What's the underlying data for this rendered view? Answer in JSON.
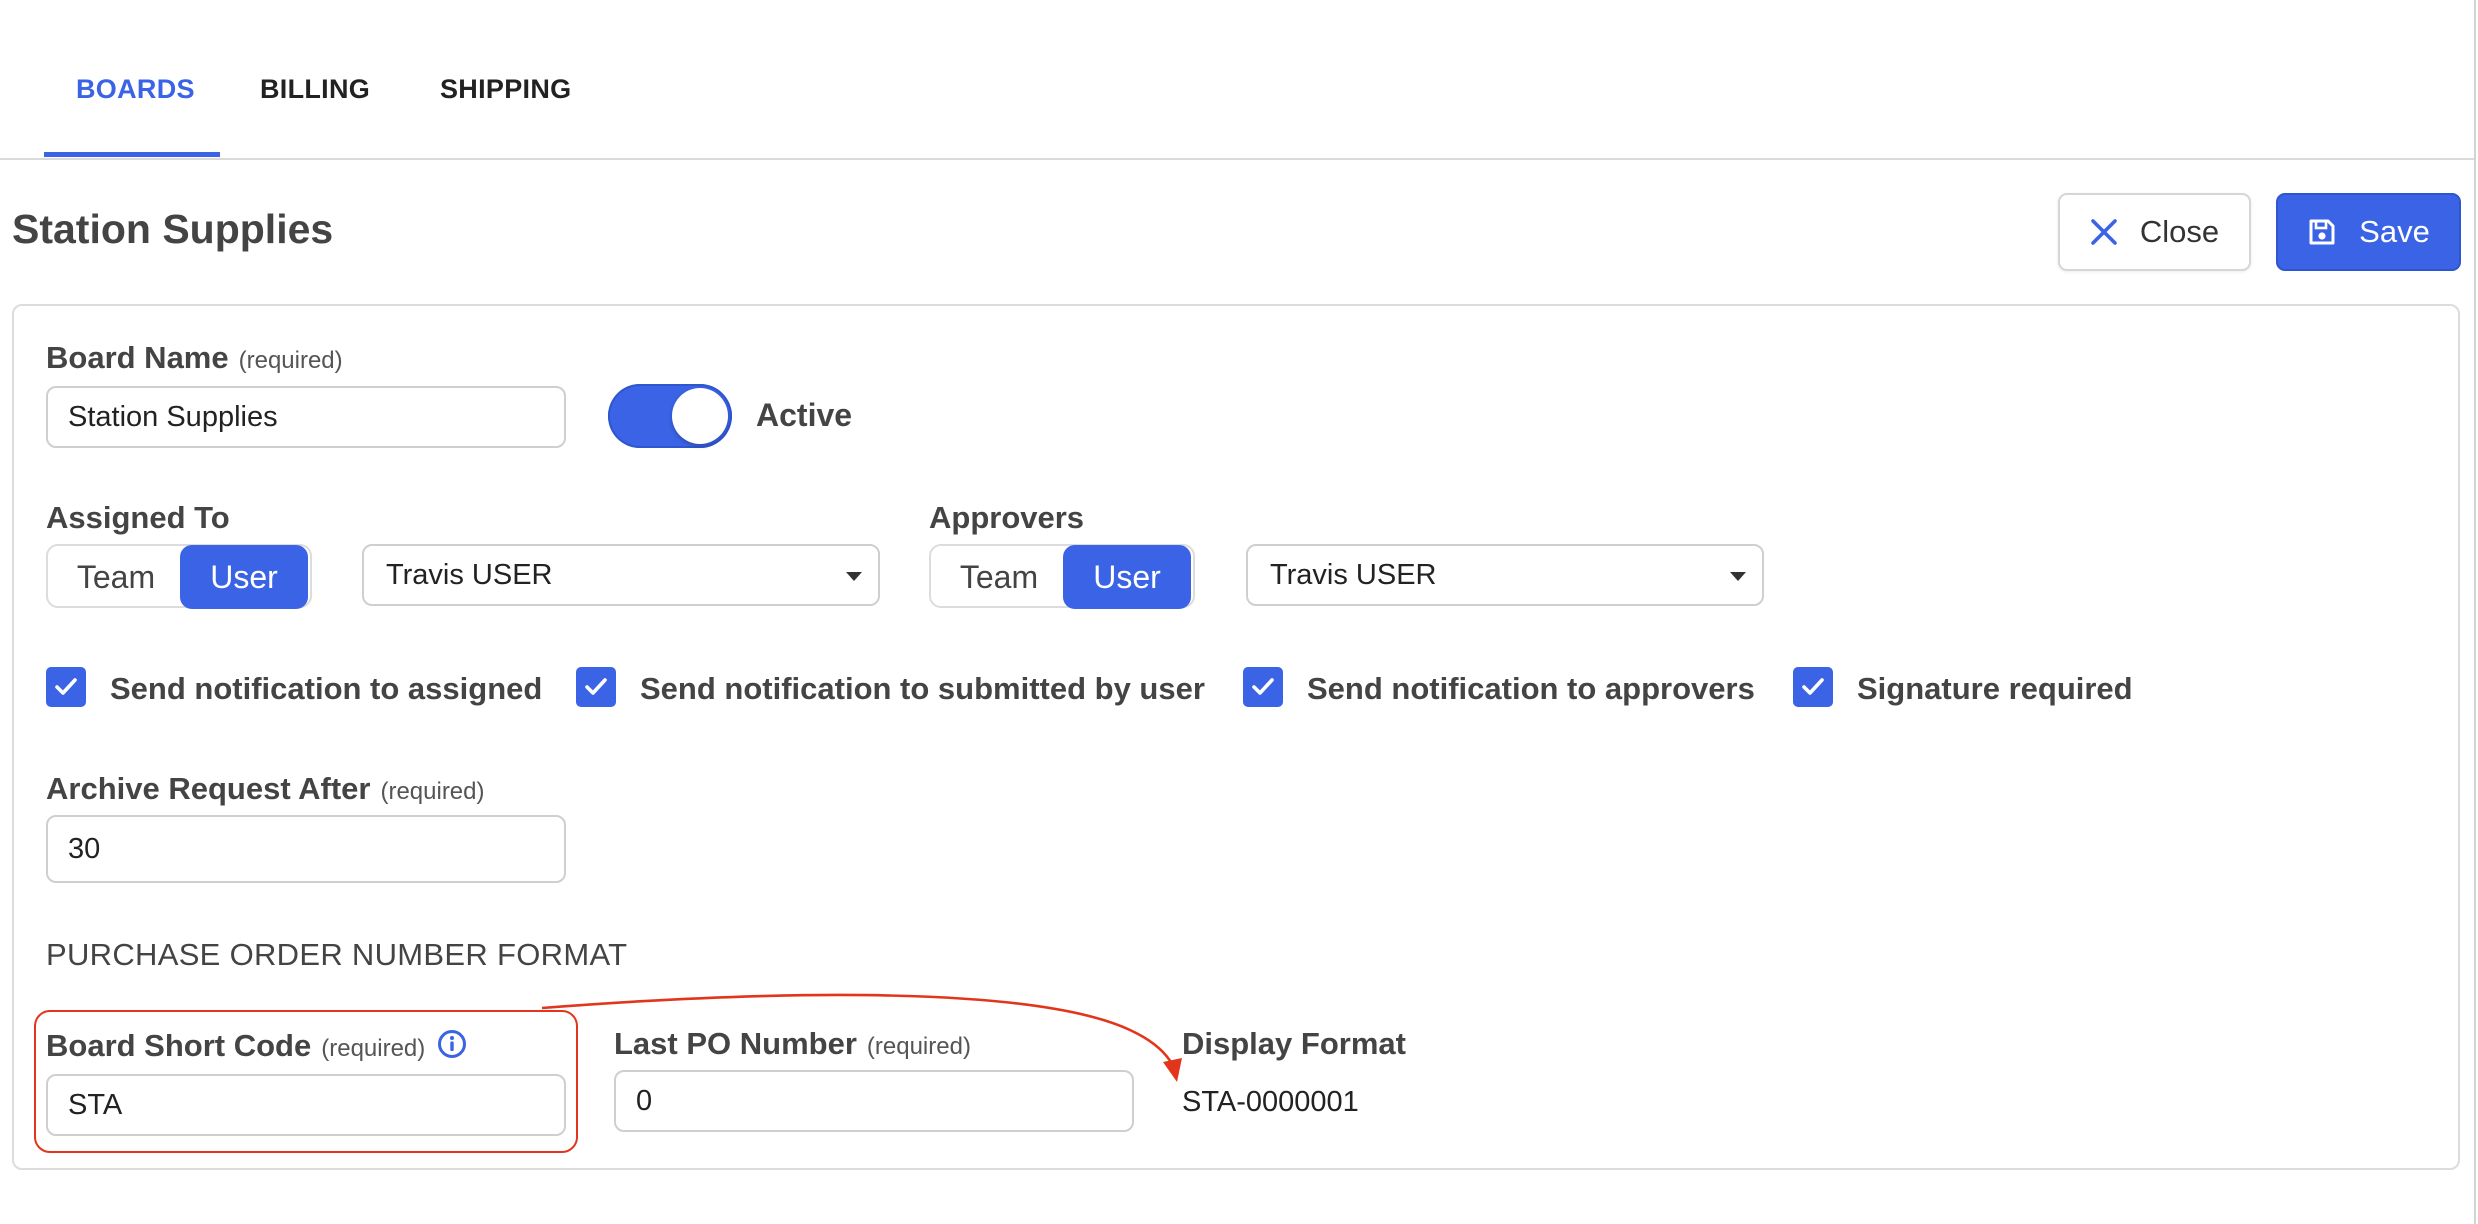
{
  "tabs": [
    {
      "label": "BOARDS",
      "active": true
    },
    {
      "label": "BILLING",
      "active": false
    },
    {
      "label": "SHIPPING",
      "active": false
    }
  ],
  "header": {
    "title": "Station Supplies",
    "close_label": "Close",
    "save_label": "Save"
  },
  "form": {
    "board_name": {
      "label": "Board Name",
      "required": "(required)",
      "value": "Station Supplies"
    },
    "active": {
      "label": "Active",
      "on": true
    },
    "assigned_to": {
      "label": "Assigned To",
      "team_label": "Team",
      "user_label": "User",
      "selected_mode": "User",
      "selected_value": "Travis USER"
    },
    "approvers": {
      "label": "Approvers",
      "team_label": "Team",
      "user_label": "User",
      "selected_mode": "User",
      "selected_value": "Travis USER"
    },
    "checkboxes": [
      {
        "label": "Send notification to assigned",
        "checked": true
      },
      {
        "label": "Send notification to submitted by user",
        "checked": true
      },
      {
        "label": "Send notification to approvers",
        "checked": true
      },
      {
        "label": "Signature required",
        "checked": true
      }
    ],
    "archive_after": {
      "label": "Archive Request After",
      "required": "(required)",
      "value": "30"
    },
    "po_section_title": "PURCHASE ORDER NUMBER FORMAT",
    "board_short_code": {
      "label": "Board Short Code",
      "required": "(required)",
      "value": "STA"
    },
    "last_po_number": {
      "label": "Last PO Number",
      "required": "(required)",
      "value": "0"
    },
    "display_format": {
      "label": "Display Format",
      "value": "STA-0000001"
    }
  },
  "colors": {
    "accent": "#3a63e6",
    "annotation": "#e2361c"
  },
  "icons": [
    "close-icon",
    "save-icon",
    "check-icon",
    "info-icon",
    "caret-down-icon"
  ]
}
